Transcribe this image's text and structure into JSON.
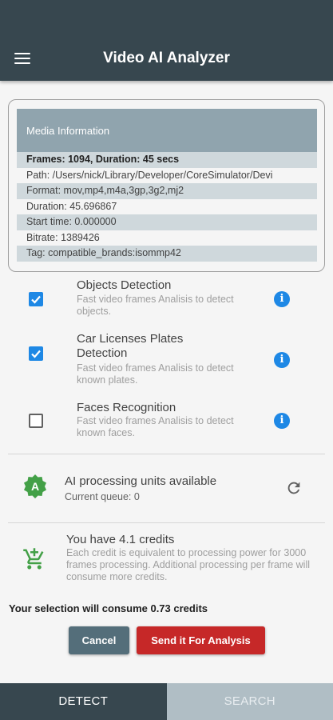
{
  "app_bar": {
    "title": "Video AI Analyzer"
  },
  "media_info": {
    "header": "Media Information",
    "rows": [
      "Frames: 1094, Duration: 45 secs",
      "Path: /Users/nick/Library/Developer/CoreSimulator/Devi",
      "Format: mov,mp4,m4a,3gp,3g2,mj2",
      "Duration: 45.696867",
      "Start time: 0.000000",
      "Bitrate: 1389426",
      "Tag: compatible_brands:isommp42"
    ]
  },
  "options": [
    {
      "title": "Objects Detection",
      "desc": "Fast video frames Analisis to detect objects.",
      "checked": true
    },
    {
      "title": "Car Licenses Plates Detection",
      "desc": "Fast video frames Analisis to detect known plates.",
      "checked": true
    },
    {
      "title": "Faces Recognition",
      "desc": "Fast video frames Analisis to detect known faces.",
      "checked": false
    }
  ],
  "ai_units": {
    "badge": "A",
    "title": "AI processing units available",
    "queue": "Current queue: 0"
  },
  "credits": {
    "title": "You have 4.1 credits",
    "desc": "Each credit is equivalent to processing power for 3000 frames processing. Additional processing per frame will consume more credits."
  },
  "consume_text": "Your selection will consume 0.73 credits",
  "buttons": {
    "cancel": "Cancel",
    "send": "Send it For Analysis"
  },
  "bottom_nav": {
    "detect": "DETECT",
    "search": "SEARCH"
  },
  "colors": {
    "appbar": "#37474f",
    "accent": "#1e88e5",
    "send": "#c62828",
    "cancel": "#546e7a",
    "badge": "#43a047"
  }
}
